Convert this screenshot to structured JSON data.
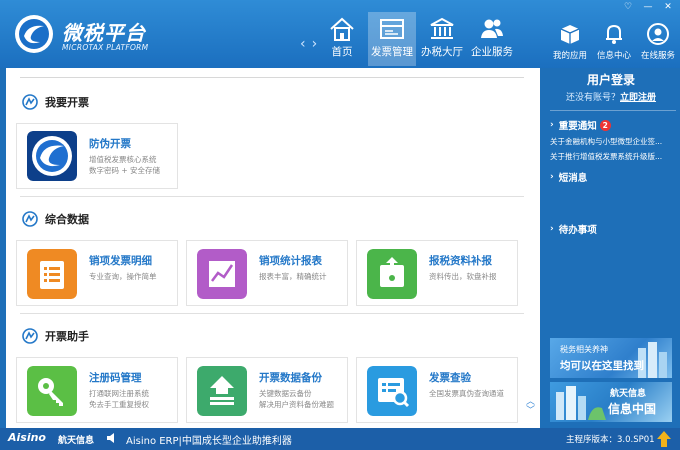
{
  "brand": {
    "name_cn": "微税平台",
    "name_en": "MICROTAX PLATFORM"
  },
  "window_controls": [
    "♡",
    "—",
    "✕"
  ],
  "nav": {
    "items": [
      {
        "label": "首页",
        "icon": "home-icon"
      },
      {
        "label": "发票管理",
        "icon": "invoice-icon",
        "active": true
      },
      {
        "label": "办税大厅",
        "icon": "bank-icon"
      },
      {
        "label": "企业服务",
        "icon": "users-icon"
      }
    ]
  },
  "quick": {
    "items": [
      {
        "label": "我的应用",
        "icon": "box-icon"
      },
      {
        "label": "信息中心",
        "icon": "bell-icon"
      },
      {
        "label": "在线服务",
        "icon": "user-circle-icon"
      }
    ]
  },
  "sections": [
    {
      "title": "我要开票",
      "cards": [
        {
          "title": "防伪开票",
          "desc": "增值税发票核心系统\n数字密码 + 安全存储",
          "icon": "tax-logo-icon",
          "color": "#1f6fd0"
        }
      ]
    },
    {
      "title": "综合数据",
      "cards": [
        {
          "title": "销项发票明细",
          "desc": "专业查询，操作简单",
          "icon": "list-icon",
          "color": "#ef8a23"
        },
        {
          "title": "销项统计报表",
          "desc": "报表丰富，精确统计",
          "icon": "chart-icon",
          "color": "#b25cc8"
        },
        {
          "title": "报税资料补报",
          "desc": "资料传出，软盘补报",
          "icon": "upload-icon",
          "color": "#4bb54a"
        }
      ]
    },
    {
      "title": "开票助手",
      "cards": [
        {
          "title": "注册码管理",
          "desc": "打通联网注册系统\n免去手工重复授权",
          "icon": "key-icon",
          "color": "#5bbf45"
        },
        {
          "title": "开票数据备份",
          "desc": "关键数据云备份\n解决用户资料备份难题",
          "icon": "backup-icon",
          "color": "#3daa6c"
        },
        {
          "title": "发票查验",
          "desc": "全国发票真伪查询通道",
          "icon": "search-doc-icon",
          "color": "#2a9be0"
        }
      ]
    }
  ],
  "right_panel": {
    "login_title": "用户登录",
    "register_prompt": "还没有账号？",
    "register_link": "立即注册",
    "notice_title": "重要通知",
    "notice_badge": "2",
    "notices": [
      "关于金融机构与小型微型企业签...",
      "关于推行增值税发票系统升级版..."
    ],
    "short_msg_title": "短消息",
    "todo_title": "待办事项",
    "banner1_line1": "税务相关养神",
    "banner1_line2": "均可以在这里找到",
    "banner2_line1": "航天信息",
    "banner2_line2": "信息中国"
  },
  "bottom": {
    "logo": "Aisino",
    "logo_cn": "航天信息",
    "slogan": "Aisino ERP|中国成长型企业助推利器",
    "version": "主程序版本：3.0.SP01"
  }
}
